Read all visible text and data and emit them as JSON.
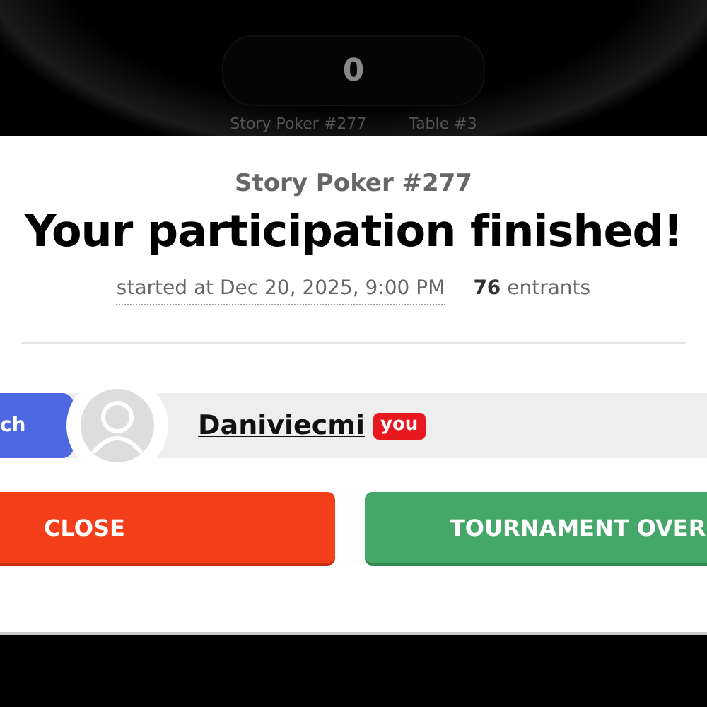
{
  "background": {
    "score": "0",
    "tournament": "Story Poker #277",
    "table": "Table #3"
  },
  "modal": {
    "subtitle": "Story Poker #277",
    "title": "Your participation finished!",
    "started": "started at Dec 20, 2025, 9:00 PM",
    "entrants": "**76** entrants",
    "player": {
      "tag": "ch",
      "name": "Daniviecmi",
      "badge": "you"
    },
    "buttons": [
      {
        "label": "CLOSE",
        "kind": "danger"
      },
      {
        "label": "TOURNAMENT OVER",
        "kind": "success"
      }
    ]
  }
}
